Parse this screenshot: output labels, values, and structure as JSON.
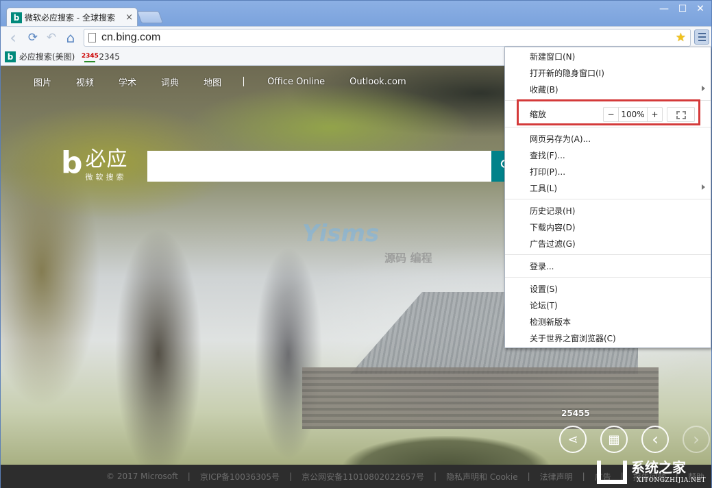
{
  "browser": {
    "tab": {
      "favicon": "b",
      "title": "微软必应搜索 - 全球搜索",
      "close_glyph": "×"
    },
    "window_controls": {
      "minimize": "—",
      "maximize": "☐",
      "close": "✕"
    },
    "nav": {
      "back": "‹",
      "reload": "⟳",
      "undo": "↶",
      "home": "⌂"
    },
    "address": {
      "url": "cn.bing.com"
    },
    "bookmarks": [
      {
        "label": "必应搜索(美图)",
        "icon": "bing-icon"
      },
      {
        "label": "2345",
        "icon": "house-icon",
        "icon_text": "2345"
      }
    ]
  },
  "page": {
    "top_nav": [
      "图片",
      "视频",
      "学术",
      "词典",
      "地图"
    ],
    "top_nav_links": [
      "Office Online",
      "Outlook.com"
    ],
    "logo": {
      "mark": "b",
      "name": "必应",
      "subtitle": "微软搜索"
    },
    "search": {
      "value": "",
      "placeholder": ""
    },
    "watermark": {
      "en": "Yisms",
      "cn": "源码 编程"
    },
    "image_count": "25455",
    "image_controls": {
      "share": "share-icon",
      "qr": "qr-code-icon",
      "prev": "‹",
      "next": "›"
    },
    "footer": [
      "© 2017 Microsoft",
      "京ICP备10036305号",
      "京公网安备11010802022657号",
      "隐私声明和 Cookie",
      "法律声明",
      "广告",
      "报告问题",
      "帮助"
    ],
    "site_watermark": {
      "cn": "系统之家",
      "en": "XITONGZHIJIA.NET"
    }
  },
  "menu": {
    "group1": [
      {
        "label": "新建窗口(N)"
      },
      {
        "label": "打开新的隐身窗口(I)"
      },
      {
        "label": "收藏(B)",
        "submenu": true
      }
    ],
    "zoom": {
      "label": "缩放",
      "minus": "−",
      "value": "100%",
      "plus": "+"
    },
    "group2": [
      {
        "label": "网页另存为(A)..."
      },
      {
        "label": "查找(F)..."
      },
      {
        "label": "打印(P)..."
      },
      {
        "label": "工具(L)",
        "submenu": true
      }
    ],
    "group3": [
      {
        "label": "历史记录(H)"
      },
      {
        "label": "下载内容(D)"
      },
      {
        "label": "广告过滤(G)"
      }
    ],
    "group4": [
      {
        "label": "登录..."
      }
    ],
    "group5": [
      {
        "label": "设置(S)"
      },
      {
        "label": "论坛(T)"
      },
      {
        "label": "检测新版本"
      },
      {
        "label": "关于世界之窗浏览器(C)"
      }
    ]
  },
  "colors": {
    "highlight": "#d43a3a",
    "bing_teal": "#00897b",
    "search_button": "#00828a"
  }
}
